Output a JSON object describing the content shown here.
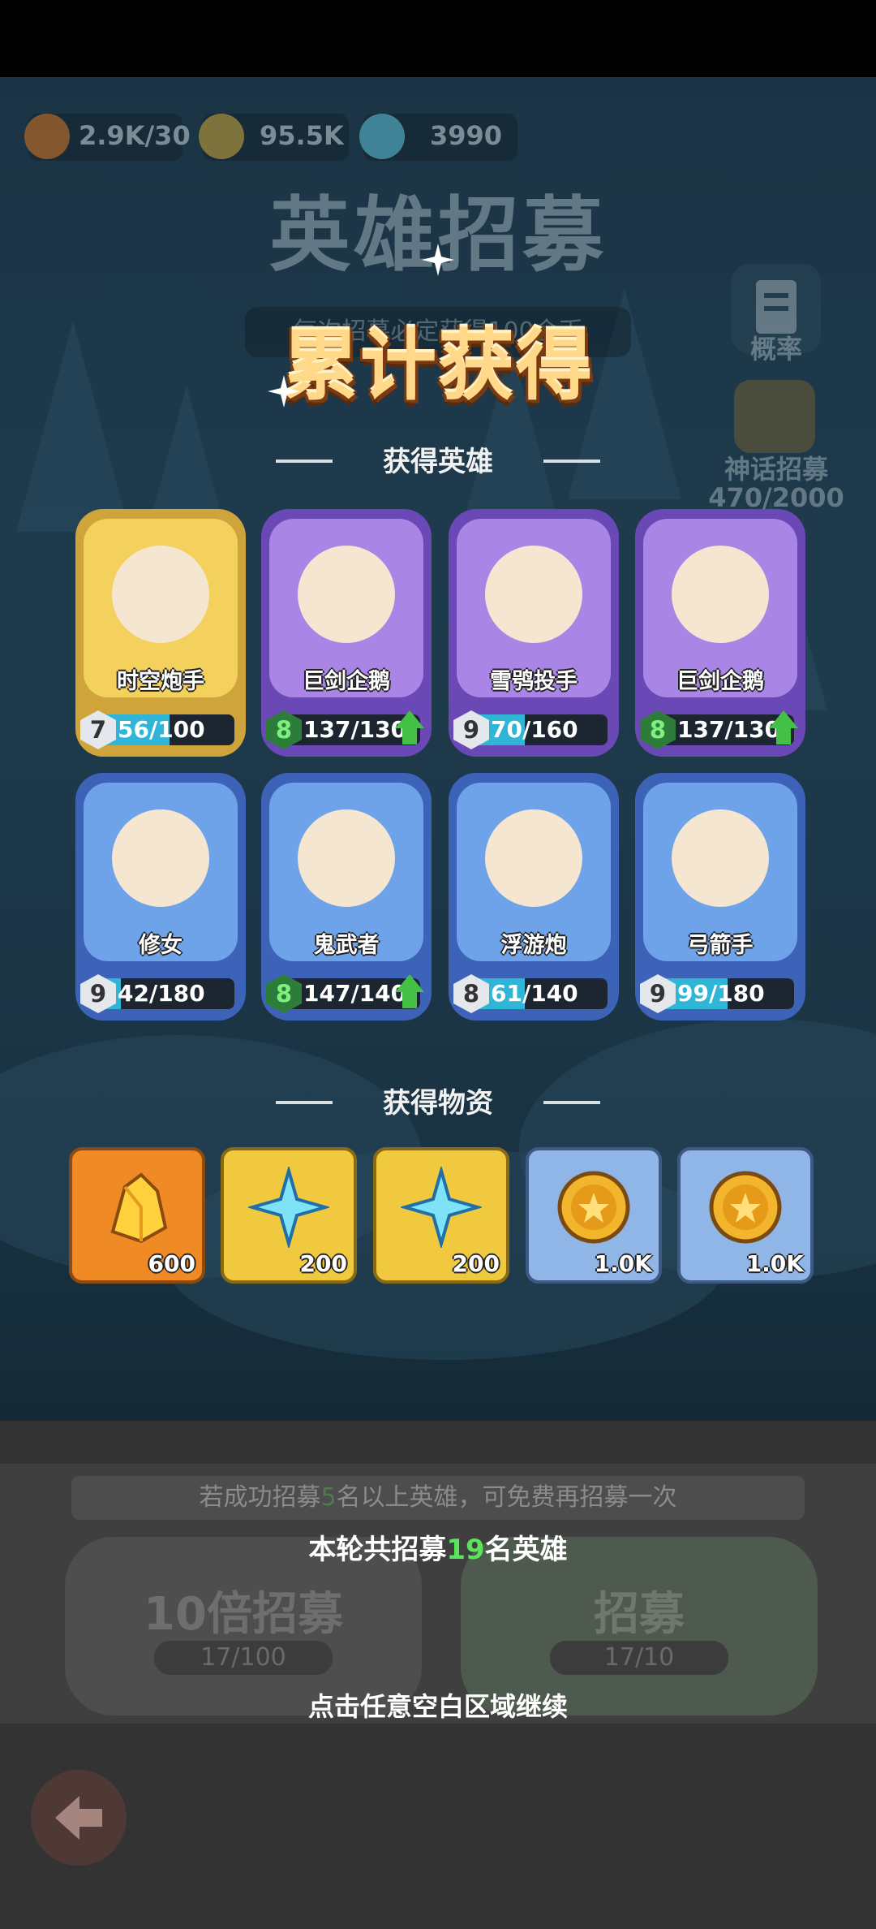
{
  "resources": {
    "energy": "2.9K/30",
    "coins": "95.5K",
    "gems": "3990"
  },
  "background": {
    "title": "英雄招募",
    "subtitle": "每次招募必定获得100金币",
    "probability_label": "概率",
    "mythic_label": "神话招募",
    "mythic_progress": "470/2000"
  },
  "main_title": "累计获得",
  "heroes_section_title": "获得英雄",
  "heroes": [
    {
      "name": "时空炮手",
      "level": "7",
      "progress": "56/100",
      "fraction": 0.56,
      "rarity": "gold",
      "upgrade": false
    },
    {
      "name": "巨剑企鹅",
      "level": "8",
      "progress": "137/130",
      "fraction": 1.0,
      "rarity": "purple",
      "upgrade": true
    },
    {
      "name": "雪鸮投手",
      "level": "9",
      "progress": "70/160",
      "fraction": 0.44,
      "rarity": "purple",
      "upgrade": false
    },
    {
      "name": "巨剑企鹅",
      "level": "8",
      "progress": "137/130",
      "fraction": 1.0,
      "rarity": "purple",
      "upgrade": true
    },
    {
      "name": "修女",
      "level": "9",
      "progress": "42/180",
      "fraction": 0.23,
      "rarity": "blue",
      "upgrade": false
    },
    {
      "name": "鬼武者",
      "level": "8",
      "progress": "147/140",
      "fraction": 1.0,
      "rarity": "blue",
      "upgrade": true
    },
    {
      "name": "浮游炮",
      "level": "8",
      "progress": "61/140",
      "fraction": 0.44,
      "rarity": "blue",
      "upgrade": false
    },
    {
      "name": "弓箭手",
      "level": "9",
      "progress": "99/180",
      "fraction": 0.55,
      "rarity": "blue",
      "upgrade": false
    }
  ],
  "items_section_title": "获得物资",
  "items": [
    {
      "icon": "gold-crystal-icon",
      "qty": "600",
      "style": "orange"
    },
    {
      "icon": "blue-snowflake-icon",
      "qty": "200",
      "style": "yellow"
    },
    {
      "icon": "blue-snowflake-icon",
      "qty": "200",
      "style": "yellow"
    },
    {
      "icon": "gold-coin-icon",
      "qty": "1.0K",
      "style": "lblue"
    },
    {
      "icon": "gold-coin-icon",
      "qty": "1.0K",
      "style": "lblue"
    }
  ],
  "bottom": {
    "hint_prefix": "若成功招募",
    "hint_count": "5",
    "hint_suffix": "名以上英雄，可免费再招募一次",
    "ten_label": "10倍招募",
    "ten_progress": "17/100",
    "single_label": "招募",
    "single_progress": "17/10",
    "summary_prefix": "本轮共招募",
    "summary_count": "19",
    "summary_suffix": "名英雄",
    "continue_text": "点击任意空白区域继续"
  },
  "colors": {
    "accent_green": "#5be35b",
    "title_gold": "#ffd88a"
  }
}
